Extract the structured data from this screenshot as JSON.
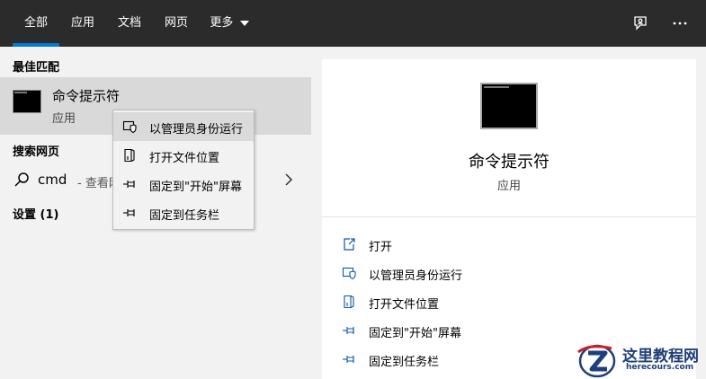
{
  "tabs": [
    {
      "label": "全部",
      "active": true
    },
    {
      "label": "应用"
    },
    {
      "label": "文档"
    },
    {
      "label": "网页"
    },
    {
      "label": "更多"
    }
  ],
  "topbar_icons": [
    "feedback-icon",
    "more-options-icon"
  ],
  "best_match": {
    "heading": "最佳匹配",
    "title": "命令提示符",
    "subtitle": "应用"
  },
  "web_search": {
    "heading": "搜索网页",
    "query": "cmd",
    "hint": "- 查看网"
  },
  "settings": {
    "heading": "设置 (1)"
  },
  "context_menu": [
    {
      "label": "以管理员身份运行",
      "icon": "shield-icon"
    },
    {
      "label": "打开文件位置",
      "icon": "file-location-icon"
    },
    {
      "label": "固定到\"开始\"屏幕",
      "icon": "pin-icon"
    },
    {
      "label": "固定到任务栏",
      "icon": "pin-icon"
    }
  ],
  "preview": {
    "title": "命令提示符",
    "subtitle": "应用",
    "actions": [
      {
        "label": "打开",
        "icon": "open-icon"
      },
      {
        "label": "以管理员身份运行",
        "icon": "shield-icon"
      },
      {
        "label": "打开文件位置",
        "icon": "file-location-icon"
      },
      {
        "label": "固定到\"开始\"屏幕",
        "icon": "pin-icon"
      },
      {
        "label": "固定到任务栏",
        "icon": "pin-icon"
      }
    ]
  },
  "watermark": {
    "name": "这里教程网",
    "url": "herecours.com"
  },
  "colors": {
    "topbar": "#2b2b2b",
    "accent": "#0078d7",
    "hover": "#d9d9d9",
    "panel": "#f2f2f2"
  }
}
